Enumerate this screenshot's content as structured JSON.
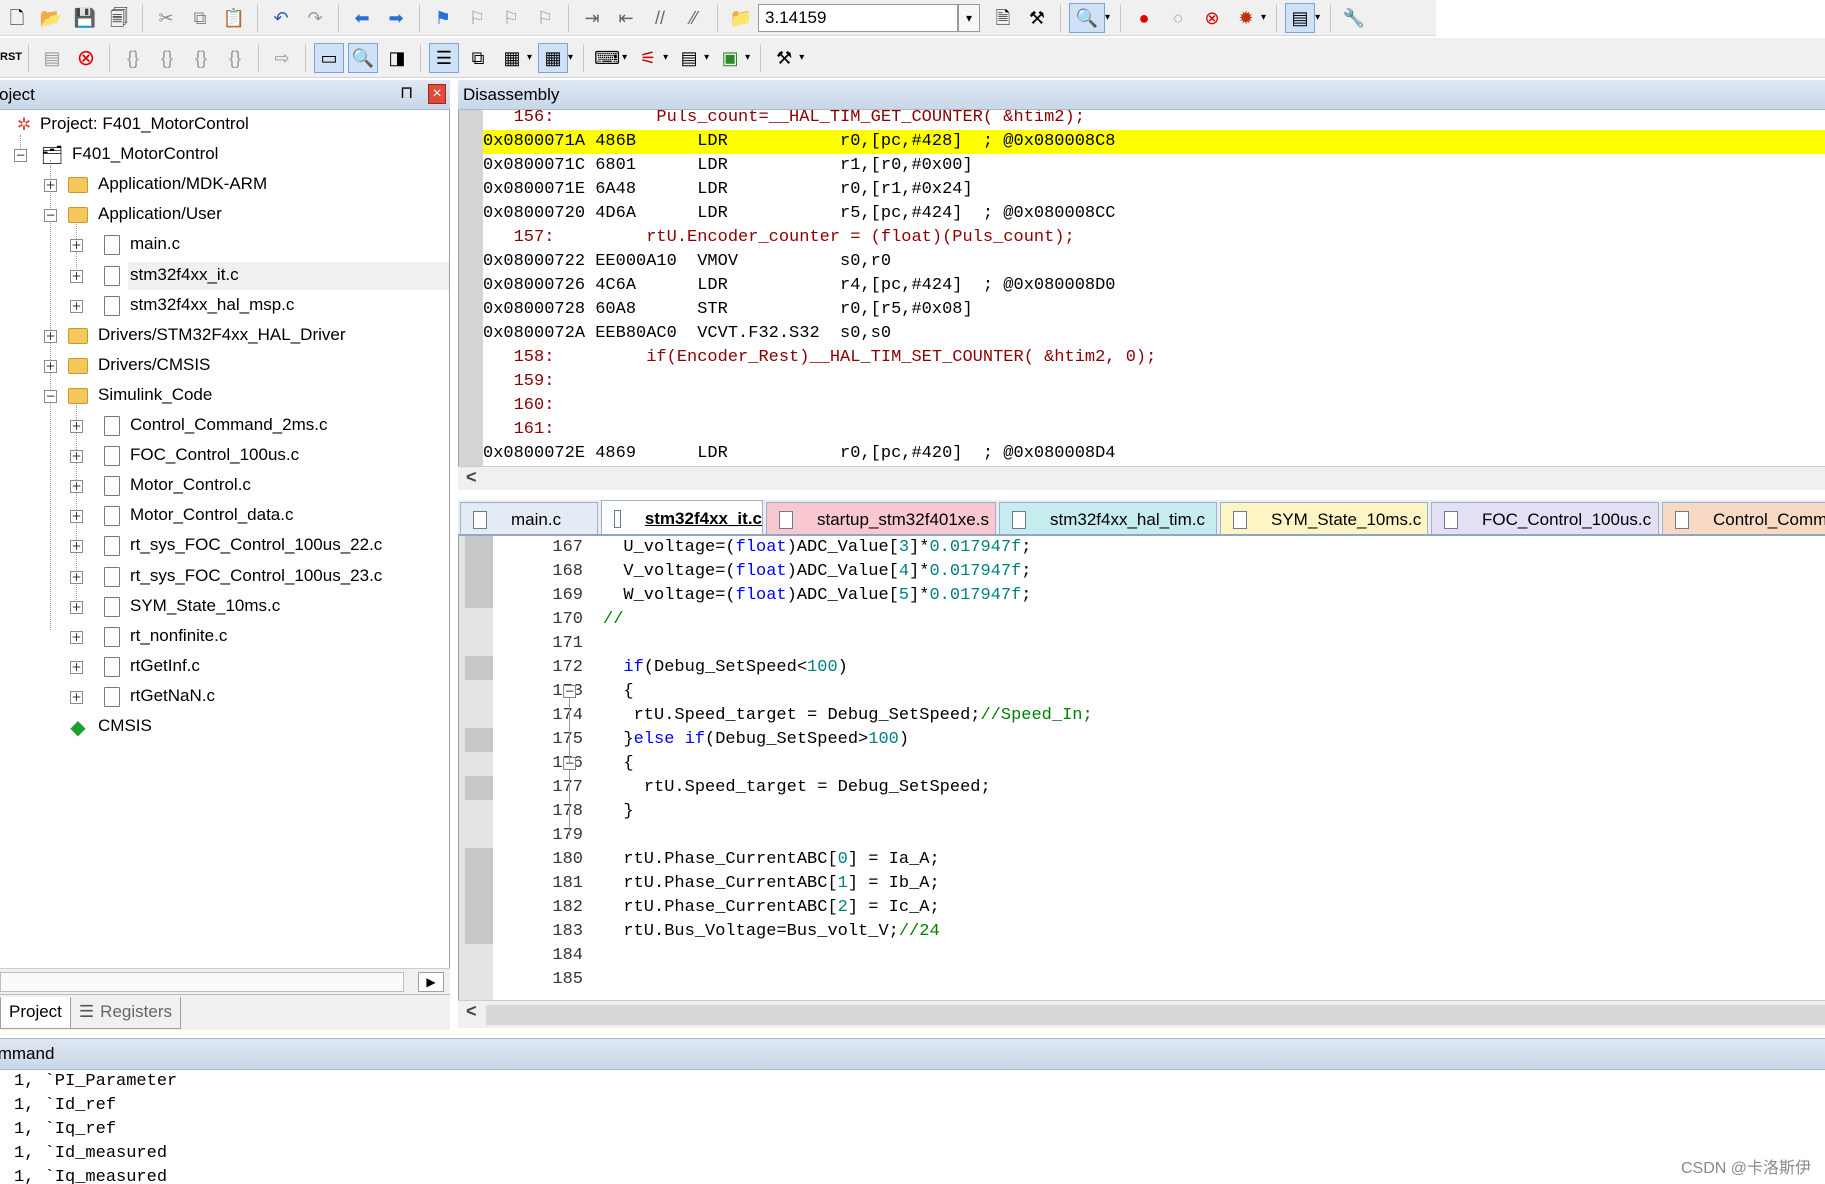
{
  "toolbar1": {
    "find_value": "3.14159",
    "icons": [
      "new-file-icon",
      "open-file-icon",
      "save-icon",
      "save-all-icon",
      "cut-icon",
      "copy-icon",
      "paste-icon",
      "undo-icon",
      "redo-icon",
      "nav-back-icon",
      "nav-forward-icon",
      "bookmark-icon",
      "bookmark-prev-icon",
      "bookmark-next-icon",
      "bookmark-clear-icon",
      "indent-icon",
      "unindent-icon",
      "comment-icon",
      "uncomment-icon",
      "find-in-files-icon",
      "find-icon",
      "incremental-find-icon",
      "debug-session-icon",
      "breakpoint-icon",
      "disable-breakpoint-icon",
      "kill-breakpoints-icon",
      "more-breakpoints-icon",
      "window-layout-icon",
      "configure-icon"
    ]
  },
  "toolbar2": {
    "rst_label": "RST"
  },
  "project_panel": {
    "title": "Project",
    "pin_glyph": "⊓",
    "close_glyph": "×",
    "tree": [
      {
        "label": "Project: F401_MotorControl",
        "level": 0,
        "kind": "project"
      },
      {
        "label": "F401_MotorControl",
        "level": 1,
        "kind": "target",
        "toggle": "−"
      },
      {
        "label": "Application/MDK-ARM",
        "level": 2,
        "kind": "folder",
        "toggle": "+"
      },
      {
        "label": "Application/User",
        "level": 2,
        "kind": "folder-open",
        "toggle": "−"
      },
      {
        "label": "main.c",
        "level": 3,
        "kind": "file",
        "toggle": "+"
      },
      {
        "label": "stm32f4xx_it.c",
        "level": 3,
        "kind": "file",
        "toggle": "+",
        "selected": true
      },
      {
        "label": "stm32f4xx_hal_msp.c",
        "level": 3,
        "kind": "file",
        "toggle": "+"
      },
      {
        "label": "Drivers/STM32F4xx_HAL_Driver",
        "level": 2,
        "kind": "folder",
        "toggle": "+"
      },
      {
        "label": "Drivers/CMSIS",
        "level": 2,
        "kind": "folder",
        "toggle": "+"
      },
      {
        "label": "Simulink_Code",
        "level": 2,
        "kind": "folder-open",
        "toggle": "−"
      },
      {
        "label": "Control_Command_2ms.c",
        "level": 3,
        "kind": "file",
        "toggle": "+"
      },
      {
        "label": "FOC_Control_100us.c",
        "level": 3,
        "kind": "file",
        "toggle": "+"
      },
      {
        "label": "Motor_Control.c",
        "level": 3,
        "kind": "file",
        "toggle": "+"
      },
      {
        "label": "Motor_Control_data.c",
        "level": 3,
        "kind": "file",
        "toggle": "+"
      },
      {
        "label": "rt_sys_FOC_Control_100us_22.c",
        "level": 3,
        "kind": "file",
        "toggle": "+"
      },
      {
        "label": "rt_sys_FOC_Control_100us_23.c",
        "level": 3,
        "kind": "file",
        "toggle": "+"
      },
      {
        "label": "SYM_State_10ms.c",
        "level": 3,
        "kind": "file",
        "toggle": "+"
      },
      {
        "label": "rt_nonfinite.c",
        "level": 3,
        "kind": "file",
        "toggle": "+"
      },
      {
        "label": "rtGetInf.c",
        "level": 3,
        "kind": "file",
        "toggle": "+"
      },
      {
        "label": "rtGetNaN.c",
        "level": 3,
        "kind": "file",
        "toggle": "+"
      },
      {
        "label": "CMSIS",
        "level": 2,
        "kind": "cmsis"
      }
    ],
    "tabs": [
      "Project",
      "Registers"
    ]
  },
  "disassembly": {
    "title": "Disassembly",
    "lines": [
      {
        "text": "   156:          Puls_count=__HAL_TIM_GET_COUNTER( &htim2);",
        "type": "src"
      },
      {
        "text": "0x0800071A 486B      LDR           r0,[pc,#428]  ; @0x080008C8",
        "type": "asm",
        "highlight": true
      },
      {
        "text": "0x0800071C 6801      LDR           r1,[r0,#0x00]",
        "type": "asm"
      },
      {
        "text": "0x0800071E 6A48      LDR           r0,[r1,#0x24]",
        "type": "asm"
      },
      {
        "text": "0x08000720 4D6A      LDR           r5,[pc,#424]  ; @0x080008CC",
        "type": "asm"
      },
      {
        "text": "   157:         rtU.Encoder_counter = (float)(Puls_count);",
        "type": "src"
      },
      {
        "text": "0x08000722 EE000A10  VMOV          s0,r0",
        "type": "asm"
      },
      {
        "text": "0x08000726 4C6A      LDR           r4,[pc,#424]  ; @0x080008D0",
        "type": "asm"
      },
      {
        "text": "0x08000728 60A8      STR           r0,[r5,#0x08]",
        "type": "asm"
      },
      {
        "text": "0x0800072A EEB80AC0  VCVT.F32.S32  s0,s0",
        "type": "asm"
      },
      {
        "text": "   158:         if(Encoder_Rest)__HAL_TIM_SET_COUNTER( &htim2, 0);",
        "type": "src"
      },
      {
        "text": "   159: ",
        "type": "src"
      },
      {
        "text": "   160: ",
        "type": "src"
      },
      {
        "text": "   161: ",
        "type": "src"
      },
      {
        "text": "0x0800072E 4869      LDR           r0,[pc,#420]  ; @0x080008D4",
        "type": "asm"
      }
    ],
    "scroll_left_glyph": "<"
  },
  "file_tabs": [
    {
      "label": "main.c",
      "bg": "#e4ebf5"
    },
    {
      "label": "stm32f4xx_it.c",
      "bg": "#ffffff",
      "active": true
    },
    {
      "label": "startup_stm32f401xe.s",
      "bg": "#f9c7cf"
    },
    {
      "label": "stm32f4xx_hal_tim.c",
      "bg": "#c7ecef"
    },
    {
      "label": "SYM_State_10ms.c",
      "bg": "#fdf6c4"
    },
    {
      "label": "FOC_Control_100us.c",
      "bg": "#e3dff5"
    },
    {
      "label": "Control_Comma",
      "bg": "#f7d9c4"
    }
  ],
  "editor": {
    "lines": [
      {
        "no": "167",
        "parts": [
          [
            "U_voltage=(",
            ""
          ],
          [
            "float",
            "kw"
          ],
          [
            ")ADC_Value[",
            ""
          ],
          [
            "3",
            "num"
          ],
          [
            "]*",
            ""
          ],
          [
            "0.017947f",
            "num"
          ],
          [
            ";",
            ""
          ]
        ],
        "indent": "  ",
        "block": true
      },
      {
        "no": "168",
        "parts": [
          [
            "V_voltage=(",
            ""
          ],
          [
            "float",
            "kw"
          ],
          [
            ")ADC_Value[",
            ""
          ],
          [
            "4",
            "num"
          ],
          [
            "]*",
            ""
          ],
          [
            "0.017947f",
            "num"
          ],
          [
            ";",
            ""
          ]
        ],
        "indent": "  ",
        "block": true
      },
      {
        "no": "169",
        "parts": [
          [
            "W_voltage=(",
            ""
          ],
          [
            "float",
            "kw"
          ],
          [
            ")ADC_Value[",
            ""
          ],
          [
            "5",
            "num"
          ],
          [
            "]*",
            ""
          ],
          [
            "0.017947f",
            "num"
          ],
          [
            ";",
            ""
          ]
        ],
        "indent": "  ",
        "block": true
      },
      {
        "no": "170",
        "parts": [
          [
            "//",
            "cmt"
          ]
        ],
        "indent": "",
        "block": false
      },
      {
        "no": "171",
        "parts": [],
        "indent": "",
        "block": false
      },
      {
        "no": "172",
        "parts": [
          [
            "if",
            "kw"
          ],
          [
            "(Debug_SetSpeed<",
            ""
          ],
          [
            "100",
            "num"
          ],
          [
            ")",
            ""
          ]
        ],
        "indent": "  ",
        "block": true
      },
      {
        "no": "173",
        "parts": [
          [
            "{",
            ""
          ]
        ],
        "indent": "  ",
        "block": false,
        "fold": "−"
      },
      {
        "no": "174",
        "parts": [
          [
            "rtU.Speed_target = Debug_SetSpeed;",
            ""
          ],
          [
            "//Speed_In;",
            "cmt"
          ]
        ],
        "indent": "   ",
        "block": false
      },
      {
        "no": "175",
        "parts": [
          [
            "}",
            ""
          ],
          [
            "else",
            "kw"
          ],
          [
            " ",
            ""
          ],
          [
            "if",
            "kw"
          ],
          [
            "(Debug_SetSpeed>",
            ""
          ],
          [
            "100",
            "num"
          ],
          [
            ")",
            ""
          ]
        ],
        "indent": "  ",
        "block": true
      },
      {
        "no": "176",
        "parts": [
          [
            "{",
            ""
          ]
        ],
        "indent": "  ",
        "block": false,
        "fold": "−"
      },
      {
        "no": "177",
        "parts": [
          [
            "rtU.Speed_target = Debug_SetSpeed;",
            ""
          ]
        ],
        "indent": "    ",
        "block": true
      },
      {
        "no": "178",
        "parts": [
          [
            "}",
            ""
          ]
        ],
        "indent": "  ",
        "block": false
      },
      {
        "no": "179",
        "parts": [],
        "indent": "",
        "block": false
      },
      {
        "no": "180",
        "parts": [
          [
            "rtU.Phase_CurrentABC[",
            ""
          ],
          [
            "0",
            "num"
          ],
          [
            "] = Ia_A;",
            ""
          ]
        ],
        "indent": "  ",
        "block": true
      },
      {
        "no": "181",
        "parts": [
          [
            "rtU.Phase_CurrentABC[",
            ""
          ],
          [
            "1",
            "num"
          ],
          [
            "] = Ib_A;",
            ""
          ]
        ],
        "indent": "  ",
        "block": true
      },
      {
        "no": "182",
        "parts": [
          [
            "rtU.Phase_CurrentABC[",
            ""
          ],
          [
            "2",
            "num"
          ],
          [
            "] = Ic_A;",
            ""
          ]
        ],
        "indent": "  ",
        "block": true
      },
      {
        "no": "183",
        "parts": [
          [
            "rtU.Bus_Voltage=Bus_volt_V;",
            ""
          ],
          [
            "//24",
            "cmt"
          ]
        ],
        "indent": "  ",
        "block": true
      },
      {
        "no": "184",
        "parts": [],
        "indent": "",
        "block": false
      },
      {
        "no": "185",
        "parts": [],
        "indent": "",
        "block": false
      }
    ],
    "scroll_left_glyph": "<"
  },
  "command": {
    "title": "Command",
    "lines": [
      "1, `PI_Parameter",
      "1, `Id_ref",
      "1, `Iq_ref",
      "1, `Id_measured",
      "1, `Iq_measured"
    ]
  },
  "watermark": "CSDN @卡洛斯伊",
  "colors": {
    "highlight": "#ffff00",
    "keyword": "#0000ff",
    "number": "#008080",
    "comment": "#008000",
    "source_line": "#8b0000"
  }
}
